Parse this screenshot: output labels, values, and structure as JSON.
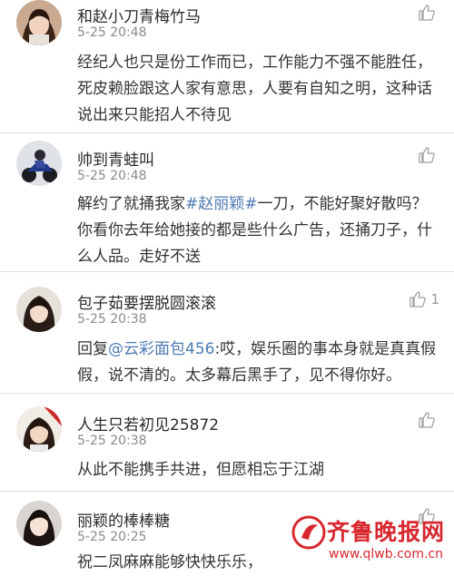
{
  "comments": [
    {
      "username": "和赵小刀青梅竹马",
      "time": "5-25 20:48",
      "text": "经纪人也只是份工作而已，工作能力不强不能胜任，死皮赖脸跟这人家有意思，人要有自知之明，这种话说出来只能招人不待见",
      "likes": ""
    },
    {
      "username": "帅到青蛙叫",
      "time": "5-25 20:48",
      "text_before": "解约了就捅我家",
      "mention": "#赵丽颖#",
      "text_after": "一刀，不能好聚好散吗？你看你去年给她接的都是些什么广告，还捅刀子，什么人品。走好不送",
      "likes": ""
    },
    {
      "username": "包子茹要摆脱圆滚滚",
      "time": "5-25 20:38",
      "reply_prefix": "回复",
      "mention": "@云彩面包456",
      "text_after": ":哎，娱乐圈的事本身就是真真假假，说不清的。太多幕后黑手了，见不得你好。",
      "likes": "1"
    },
    {
      "username": "人生只若初见25872",
      "time": "5-25 20:38",
      "text": "从此不能携手共进，但愿相忘于江湖",
      "likes": ""
    },
    {
      "username": "丽颖的棒棒糖",
      "time": "5-25 20:25",
      "text": "祝二凤麻麻能够快快乐乐，",
      "likes": ""
    }
  ],
  "watermark": {
    "title": "齐鲁晚报网",
    "url": "www.qlwb.com.cn"
  },
  "icons": {
    "like": "thumbs-up-icon"
  },
  "colors": {
    "link": "#4d7ab3",
    "watermark": "#d8282f"
  }
}
